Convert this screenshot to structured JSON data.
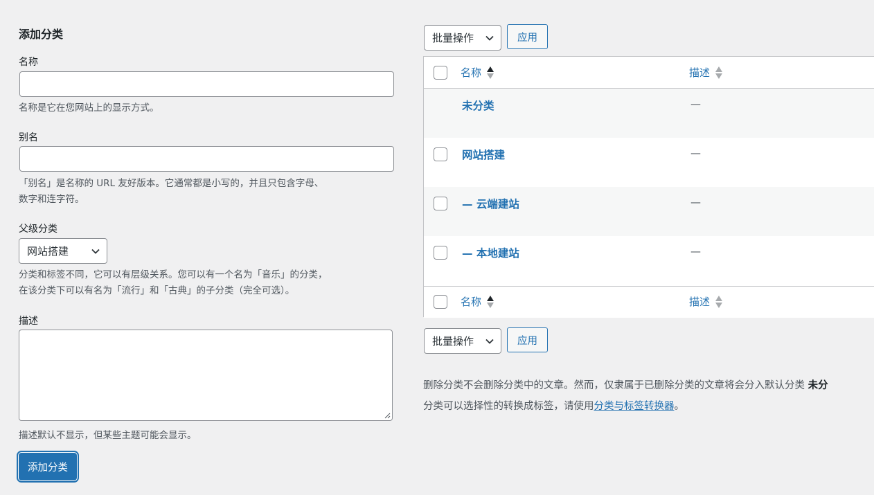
{
  "form": {
    "title": "添加分类",
    "name_label": "名称",
    "name_value": "",
    "name_help": "名称是它在您网站上的显示方式。",
    "slug_label": "别名",
    "slug_value": "",
    "slug_help_line1": "「别名」是名称的 URL 友好版本。它通常都是小写的，并且只包含字母、",
    "slug_help_line2": "数字和连字符。",
    "parent_label": "父级分类",
    "parent_selected": "网站搭建",
    "parent_help_line1": "分类和标签不同，它可以有层级关系。您可以有一个名为「音乐」的分类，",
    "parent_help_line2": "在该分类下可以有名为「流行」和「古典」的子分类（完全可选）。",
    "desc_label": "描述",
    "desc_value": "",
    "desc_help": "描述默认不显示，但某些主题可能会显示。",
    "submit_label": "添加分类"
  },
  "list": {
    "bulk_actions_label": "批量操作",
    "apply_label": "应用",
    "columns": {
      "name": "名称",
      "description": "描述"
    },
    "rows": [
      {
        "name": "未分类",
        "description": "—",
        "has_checkbox": false
      },
      {
        "name": "网站搭建",
        "description": "—",
        "has_checkbox": true
      },
      {
        "name": "— 云端建站",
        "description": "—",
        "has_checkbox": true
      },
      {
        "name": "— 本地建站",
        "description": "—",
        "has_checkbox": true
      }
    ],
    "note_line1": "删除分类不会删除分类中的文章。然而，仅隶属于已删除分类的文章将会分入默认分类",
    "note_default_category": "未分",
    "note_line2_prefix": "分类可以选择性的转换成标签，请使用",
    "note_link": "分类与标签转换器",
    "note_line2_suffix": "。"
  },
  "colors": {
    "accent": "#2271b1",
    "background": "#f0f0f1",
    "text": "#3c434a"
  },
  "icons": [
    "chevron-down-icon",
    "sort-icon",
    "resize-grip-icon"
  ]
}
